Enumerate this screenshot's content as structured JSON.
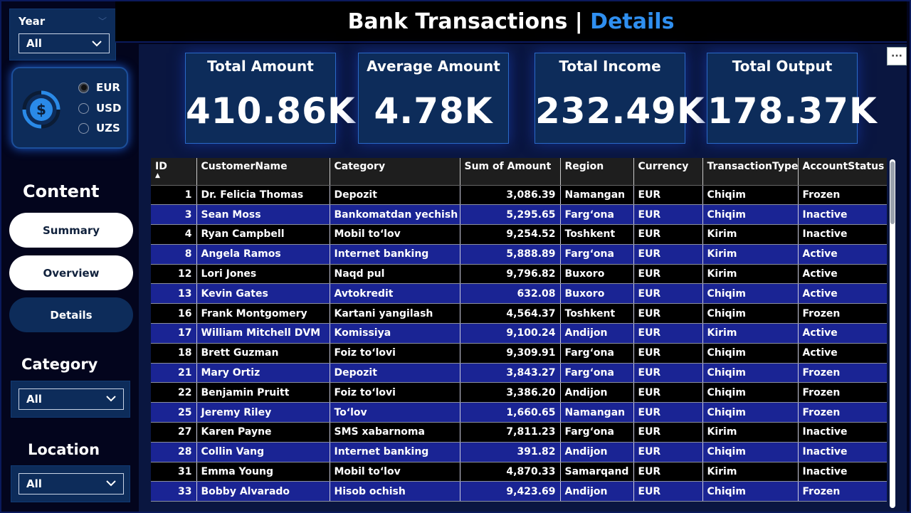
{
  "header": {
    "title_main": "Bank Transactions | ",
    "title_accent": "Details"
  },
  "year_slicer": {
    "label": "Year",
    "value": "All"
  },
  "currency": {
    "options": [
      {
        "label": "EUR",
        "selected": true
      },
      {
        "label": "USD",
        "selected": false
      },
      {
        "label": "UZS",
        "selected": false
      }
    ]
  },
  "content": {
    "heading": "Content",
    "buttons": {
      "summary": "Summary",
      "overview": "Overview",
      "details": "Details"
    }
  },
  "category_slicer": {
    "heading": "Category",
    "value": "All"
  },
  "location_slicer": {
    "heading": "Location",
    "value": "All"
  },
  "kpis": [
    {
      "title": "Total Amount",
      "value": "410.86K"
    },
    {
      "title": "Average Amount",
      "value": "4.78K"
    },
    {
      "title": "Total Income",
      "value": "232.49K"
    },
    {
      "title": "Total Output",
      "value": "178.37K"
    }
  ],
  "more_button": "···",
  "table": {
    "columns": [
      "ID",
      "CustomerName",
      "Category",
      "Sum of Amount",
      "Region",
      "Currency",
      "TransactionType",
      "AccountStatus"
    ],
    "sort_indicator": "▲",
    "rows": [
      [
        "1",
        "Dr. Felicia Thomas",
        "Depozit",
        "3,086.39",
        "Namangan",
        "EUR",
        "Chiqim",
        "Frozen"
      ],
      [
        "3",
        "Sean Moss",
        "Bankomatdan yechish",
        "5,295.65",
        "Farg‘ona",
        "EUR",
        "Chiqim",
        "Inactive"
      ],
      [
        "4",
        "Ryan Campbell",
        "Mobil to‘lov",
        "9,254.52",
        "Toshkent",
        "EUR",
        "Kirim",
        "Inactive"
      ],
      [
        "8",
        "Angela Ramos",
        "Internet banking",
        "5,888.89",
        "Farg‘ona",
        "EUR",
        "Kirim",
        "Active"
      ],
      [
        "12",
        "Lori Jones",
        "Naqd pul",
        "9,796.82",
        "Buxoro",
        "EUR",
        "Kirim",
        "Active"
      ],
      [
        "13",
        "Kevin Gates",
        "Avtokredit",
        "632.08",
        "Buxoro",
        "EUR",
        "Chiqim",
        "Active"
      ],
      [
        "16",
        "Frank Montgomery",
        "Kartani yangilash",
        "4,564.37",
        "Toshkent",
        "EUR",
        "Chiqim",
        "Frozen"
      ],
      [
        "17",
        "William Mitchell DVM",
        "Komissiya",
        "9,100.24",
        "Andijon",
        "EUR",
        "Kirim",
        "Active"
      ],
      [
        "18",
        "Brett Guzman",
        "Foiz to‘lovi",
        "9,309.91",
        "Farg‘ona",
        "EUR",
        "Chiqim",
        "Active"
      ],
      [
        "21",
        "Mary Ortiz",
        "Depozit",
        "3,843.27",
        "Farg‘ona",
        "EUR",
        "Chiqim",
        "Frozen"
      ],
      [
        "22",
        "Benjamin Pruitt",
        "Foiz to‘lovi",
        "3,386.20",
        "Andijon",
        "EUR",
        "Chiqim",
        "Frozen"
      ],
      [
        "25",
        "Jeremy Riley",
        "To‘lov",
        "1,660.65",
        "Namangan",
        "EUR",
        "Chiqim",
        "Frozen"
      ],
      [
        "27",
        "Karen Payne",
        "SMS xabarnoma",
        "7,811.23",
        "Farg‘ona",
        "EUR",
        "Kirim",
        "Inactive"
      ],
      [
        "28",
        "Collin Vang",
        "Internet banking",
        "391.82",
        "Andijon",
        "EUR",
        "Chiqim",
        "Inactive"
      ],
      [
        "31",
        "Emma Young",
        "Mobil to‘lov",
        "4,870.33",
        "Samarqand",
        "EUR",
        "Kirim",
        "Inactive"
      ],
      [
        "33",
        "Bobby Alvarado",
        "Hisob ochish",
        "9,423.69",
        "Andijon",
        "EUR",
        "Chiqim",
        "Frozen"
      ]
    ]
  }
}
